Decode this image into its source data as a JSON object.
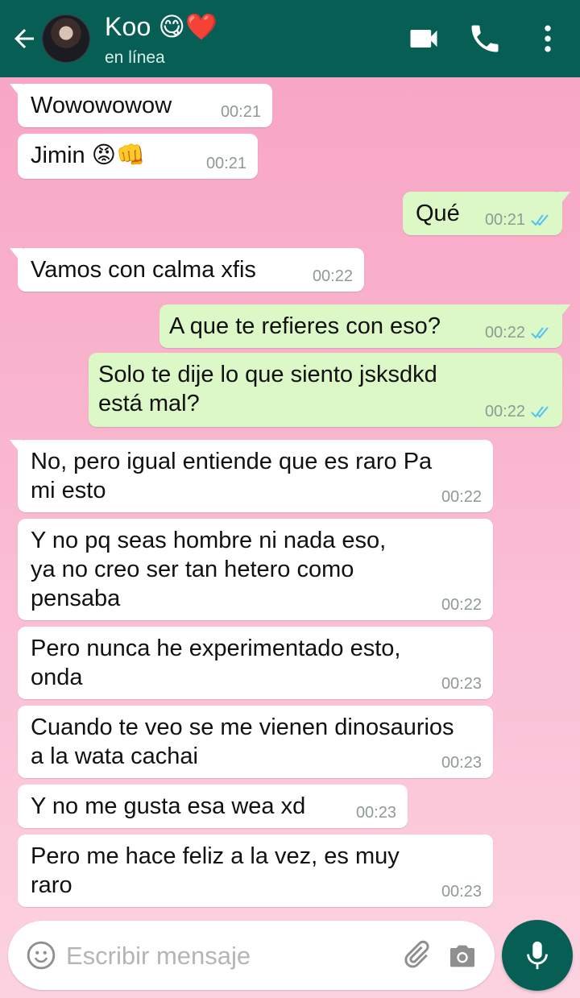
{
  "header": {
    "contact_name": "Koo 😋❤️",
    "status": "en línea",
    "colors": {
      "bar": "#075e54",
      "icon": "#ffffff"
    },
    "icons": [
      "back-arrow-icon",
      "video-call-icon",
      "phone-call-icon",
      "more-options-icon"
    ]
  },
  "messages": [
    {
      "dir": "in",
      "text": "Wowowowow",
      "time": "00:21"
    },
    {
      "dir": "in",
      "text": "Jimin 😡👊",
      "time": "00:21"
    },
    {
      "dir": "out",
      "text": "Qué",
      "time": "00:21",
      "status": "read"
    },
    {
      "dir": "in",
      "text": "Vamos con calma xfis",
      "time": "00:22"
    },
    {
      "dir": "out",
      "text": "A que te refieres con eso?",
      "time": "00:22",
      "status": "read"
    },
    {
      "dir": "out",
      "text": "Solo te dije lo que siento jsksdkd\nestá mal?",
      "time": "00:22",
      "status": "read"
    },
    {
      "dir": "in",
      "text": "No, pero igual entiende que es raro Pa\nmi esto",
      "time": "00:22"
    },
    {
      "dir": "in",
      "text": "Y no pq seas hombre ni nada eso,\nya no creo ser tan hetero como\npensaba",
      "time": "00:22"
    },
    {
      "dir": "in",
      "text": "Pero nunca he experimentado esto,\nonda",
      "time": "00:23"
    },
    {
      "dir": "in",
      "text": "Cuando te veo se me vienen dinosaurios\na la wata cachai",
      "time": "00:23"
    },
    {
      "dir": "in",
      "text": "Y no me gusta esa wea xd",
      "time": "00:23"
    },
    {
      "dir": "in",
      "text": "Pero me hace feliz a la vez, es muy\nraro",
      "time": "00:23"
    }
  ],
  "composer": {
    "placeholder": "Escribir mensaje",
    "icons": [
      "emoji-icon",
      "attach-icon",
      "camera-icon",
      "microphone-icon"
    ]
  },
  "colors": {
    "incoming_bubble": "#ffffff",
    "outgoing_bubble": "#dcf8c6",
    "read_ticks": "#4fc3f7",
    "time_text": "#8d9a95"
  }
}
